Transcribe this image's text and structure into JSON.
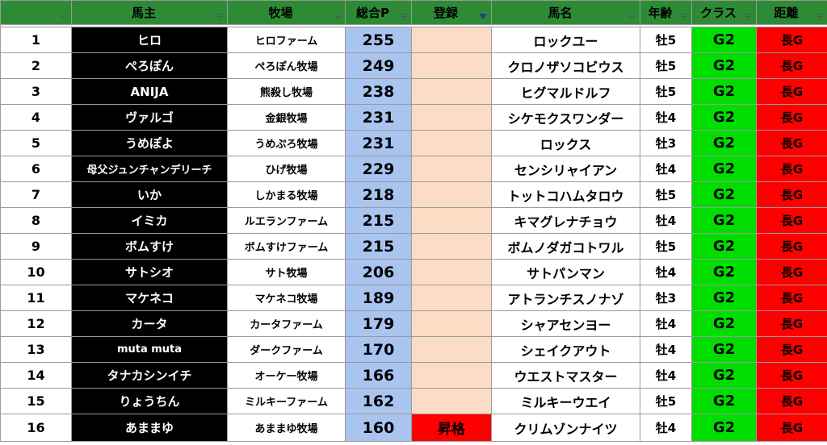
{
  "headers": {
    "rank": "",
    "owner": "馬主",
    "farm": "牧場",
    "points": "総合P",
    "registration": "登録",
    "horse": "馬名",
    "age": "年齢",
    "class": "クラス",
    "distance": "距離"
  },
  "rows": [
    {
      "rank": "1",
      "owner": "ヒロ",
      "farm": "ヒロファーム",
      "points": "255",
      "registration": "",
      "horse": "ロックユー",
      "age": "牡5",
      "class": "G2",
      "distance": "長G"
    },
    {
      "rank": "2",
      "owner": "ぺろぽん",
      "farm": "ぺろぽん牧場",
      "points": "249",
      "registration": "",
      "horse": "クロノザソコビウス",
      "age": "牡5",
      "class": "G2",
      "distance": "長G"
    },
    {
      "rank": "3",
      "owner": "ANIJA",
      "farm": "熊殺し牧場",
      "points": "238",
      "registration": "",
      "horse": "ヒグマルドルフ",
      "age": "牡5",
      "class": "G2",
      "distance": "長G"
    },
    {
      "rank": "4",
      "owner": "ヴァルゴ",
      "farm": "金銀牧場",
      "points": "231",
      "registration": "",
      "horse": "シケモクスワンダー",
      "age": "牡4",
      "class": "G2",
      "distance": "長G"
    },
    {
      "rank": "5",
      "owner": "うめぽよ",
      "farm": "うめぷろ牧場",
      "points": "231",
      "registration": "",
      "horse": "ロックス",
      "age": "牡3",
      "class": "G2",
      "distance": "長G"
    },
    {
      "rank": "6",
      "owner": "母父ジュンチャンデリーチ",
      "farm": "ひげ牧場",
      "points": "229",
      "registration": "",
      "horse": "センシリャイアン",
      "age": "牡4",
      "class": "G2",
      "distance": "長G"
    },
    {
      "rank": "7",
      "owner": "いか",
      "farm": "しかまる牧場",
      "points": "218",
      "registration": "",
      "horse": "トットコハムタロウ",
      "age": "牡5",
      "class": "G2",
      "distance": "長G"
    },
    {
      "rank": "8",
      "owner": "イミカ",
      "farm": "ルエランファーム",
      "points": "215",
      "registration": "",
      "horse": "キマグレナチョウ",
      "age": "牡4",
      "class": "G2",
      "distance": "長G"
    },
    {
      "rank": "9",
      "owner": "ボムすけ",
      "farm": "ボムすけファーム",
      "points": "215",
      "registration": "",
      "horse": "ボムノダガコトワル",
      "age": "牡5",
      "class": "G2",
      "distance": "長G"
    },
    {
      "rank": "10",
      "owner": "サトシオ",
      "farm": "サト牧場",
      "points": "206",
      "registration": "",
      "horse": "サトパンマン",
      "age": "牡4",
      "class": "G2",
      "distance": "長G"
    },
    {
      "rank": "11",
      "owner": "マケネコ",
      "farm": "マケネコ牧場",
      "points": "189",
      "registration": "",
      "horse": "アトランチスノナゾ",
      "age": "牡3",
      "class": "G2",
      "distance": "長G"
    },
    {
      "rank": "12",
      "owner": "カータ",
      "farm": "カータファーム",
      "points": "179",
      "registration": "",
      "horse": "シャアセンヨー",
      "age": "牡4",
      "class": "G2",
      "distance": "長G"
    },
    {
      "rank": "13",
      "owner": "muta muta",
      "farm": "ダークファーム",
      "points": "170",
      "registration": "",
      "horse": "シェイクアウト",
      "age": "牡4",
      "class": "G2",
      "distance": "長G"
    },
    {
      "rank": "14",
      "owner": "タナカシンイチ",
      "farm": "オーケー牧場",
      "points": "166",
      "registration": "",
      "horse": "ウエストマスター",
      "age": "牡4",
      "class": "G2",
      "distance": "長G"
    },
    {
      "rank": "15",
      "owner": "りょうちん",
      "farm": "ミルキーファーム",
      "points": "162",
      "registration": "",
      "horse": "ミルキーウエイ",
      "age": "牡5",
      "class": "G2",
      "distance": "長G"
    },
    {
      "rank": "16",
      "owner": "あままゆ",
      "farm": "あままゆ牧場",
      "points": "160",
      "registration": "昇格",
      "horse": "クリムゾンナイツ",
      "age": "牡4",
      "class": "G2",
      "distance": "長G"
    }
  ],
  "colors": {
    "header_bg": "#2e8b35",
    "owner_bg": "#000000",
    "points_bg": "#a9c4ef",
    "registration_bg": "#fcdcc4",
    "promotion_bg": "#ff0000",
    "class_bg": "#00dd00",
    "distance_bg": "#ff0000"
  },
  "icons": {
    "filter": "filter-dropdown-icon",
    "active_filter": "funnel-filter-icon"
  }
}
